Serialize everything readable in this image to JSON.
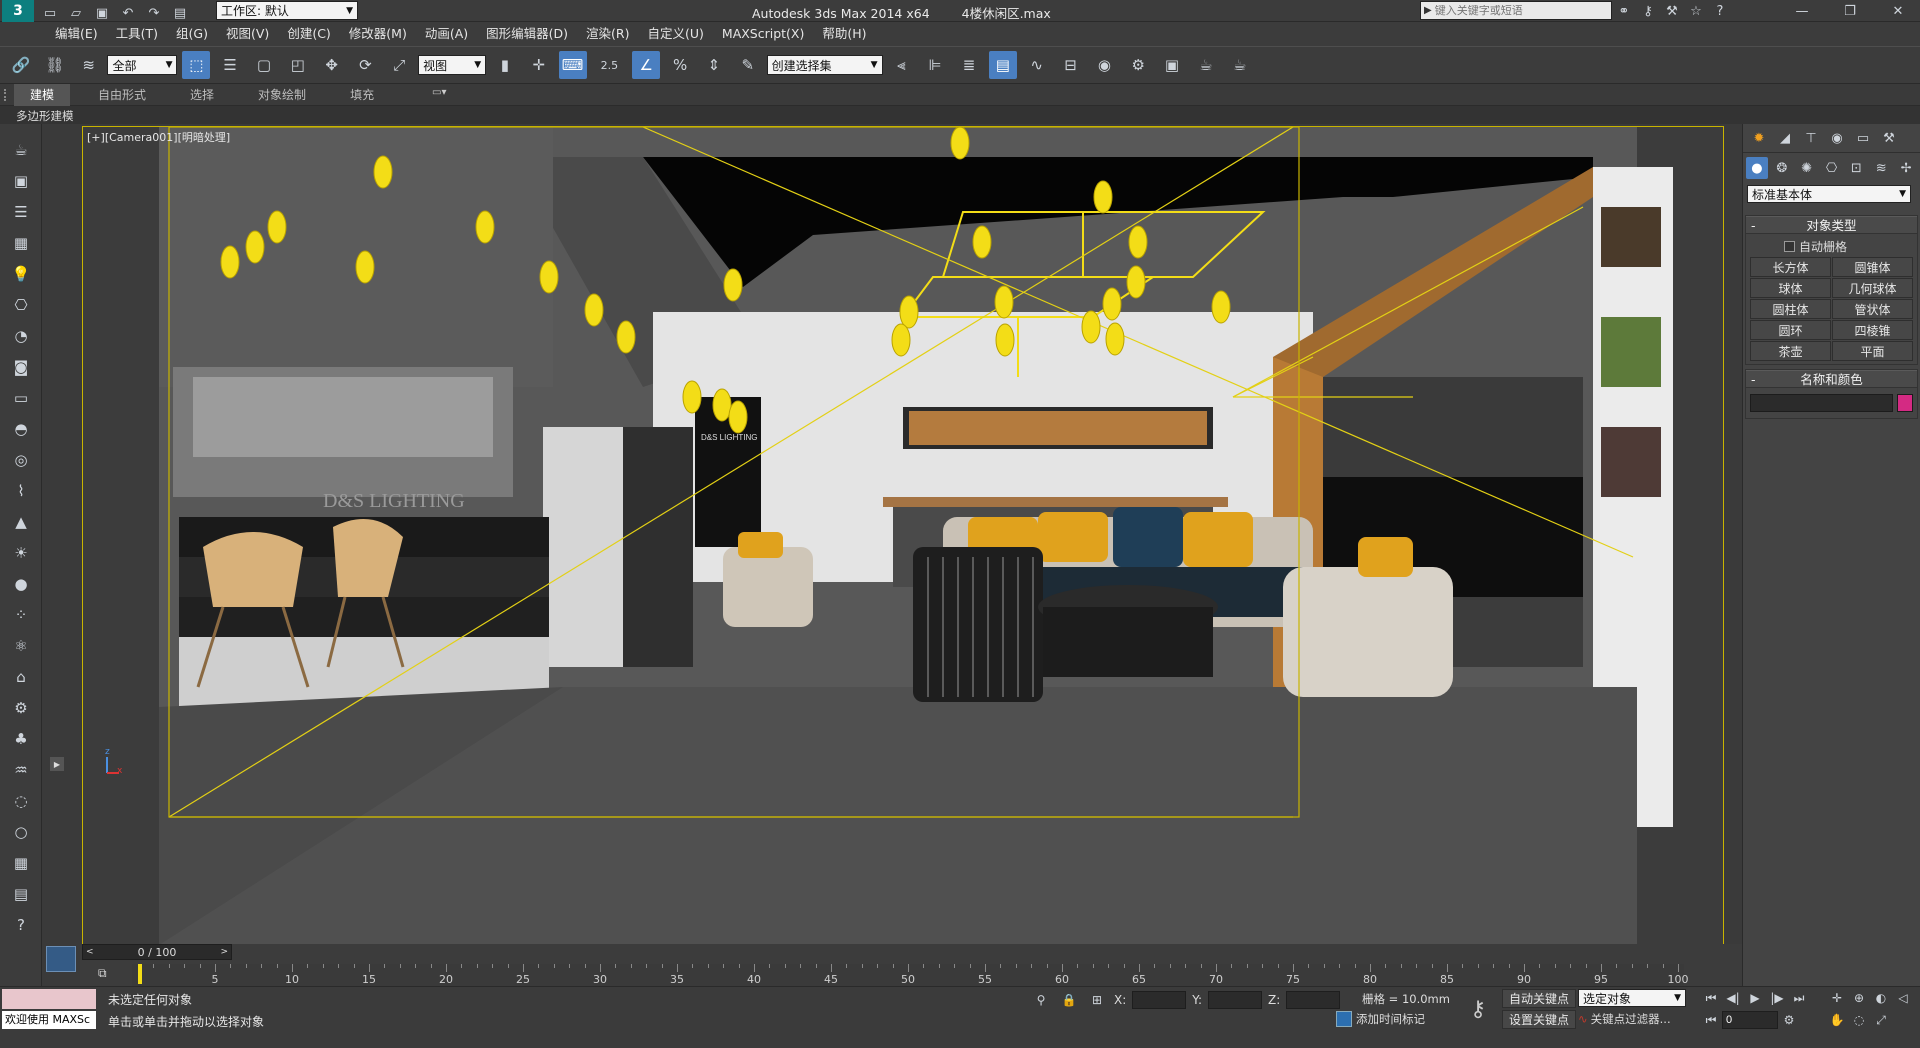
{
  "titlebar": {
    "app_name": "Autodesk 3ds Max  2014 x64",
    "file_name": "4楼休闲区.max",
    "workspace_label": "工作区: 默认",
    "search_placeholder": "键入关键字或短语"
  },
  "menubar": {
    "items": [
      "编辑(E)",
      "工具(T)",
      "组(G)",
      "视图(V)",
      "创建(C)",
      "修改器(M)",
      "动画(A)",
      "图形编辑器(D)",
      "渲染(R)",
      "自定义(U)",
      "MAXScript(X)",
      "帮助(H)"
    ]
  },
  "maintoolbar": {
    "selection_filter": "全部",
    "ref_coord": "视图",
    "snap_value": "2.5",
    "named_selection": "创建选择集"
  },
  "ribbon": {
    "tabs": [
      "建模",
      "自由形式",
      "选择",
      "对象绘制",
      "填充"
    ],
    "subtitle": "多边形建模"
  },
  "viewport": {
    "label": "[+][Camera001][明暗处理]",
    "label_plus": "[+]",
    "label_camera": "[Camera001]",
    "label_shading": "[明暗处理]",
    "brand_text": "D&S LIGHTING",
    "brand_text_2": "D&S LIGHTING",
    "axis_x": "x",
    "axis_z": "z"
  },
  "command_panel": {
    "category": "标准基本体",
    "rollout_object_type": "对象类型",
    "auto_grid": "自动栅格",
    "objects": [
      "长方体",
      "圆锥体",
      "球体",
      "几何球体",
      "圆柱体",
      "管状体",
      "圆环",
      "四棱锥",
      "茶壶",
      "平面"
    ],
    "rollout_name_color": "名称和颜色",
    "object_color": "#d42a83",
    "badge": "60"
  },
  "timeline": {
    "frame_display": "0 / 100",
    "ticks": [
      0,
      5,
      10,
      15,
      20,
      25,
      30,
      35,
      40,
      45,
      50,
      55,
      60,
      65,
      70,
      75,
      80,
      85,
      90,
      95,
      100
    ]
  },
  "statusbar": {
    "maxscript_label": "欢迎使用 MAXSc",
    "status_line_1": "未选定任何对象",
    "status_line_2": "单击或单击并拖动以选择对象",
    "x_label": "X:",
    "y_label": "Y:",
    "z_label": "Z:",
    "grid_label": "栅格 = 10.0mm",
    "add_time_tag": "添加时间标记",
    "auto_key": "自动关键点",
    "set_key": "设置关键点",
    "selected_object": "选定对象",
    "key_filters": "关键点过滤器...",
    "current_frame": "0"
  },
  "colors": {
    "ui_bg": "#3c3c3c",
    "accent_blue": "#4a7fc1",
    "viewport_border": "#c8b400",
    "light_yellow": "#f3dd17",
    "pillow_orange": "#e0a21d"
  }
}
